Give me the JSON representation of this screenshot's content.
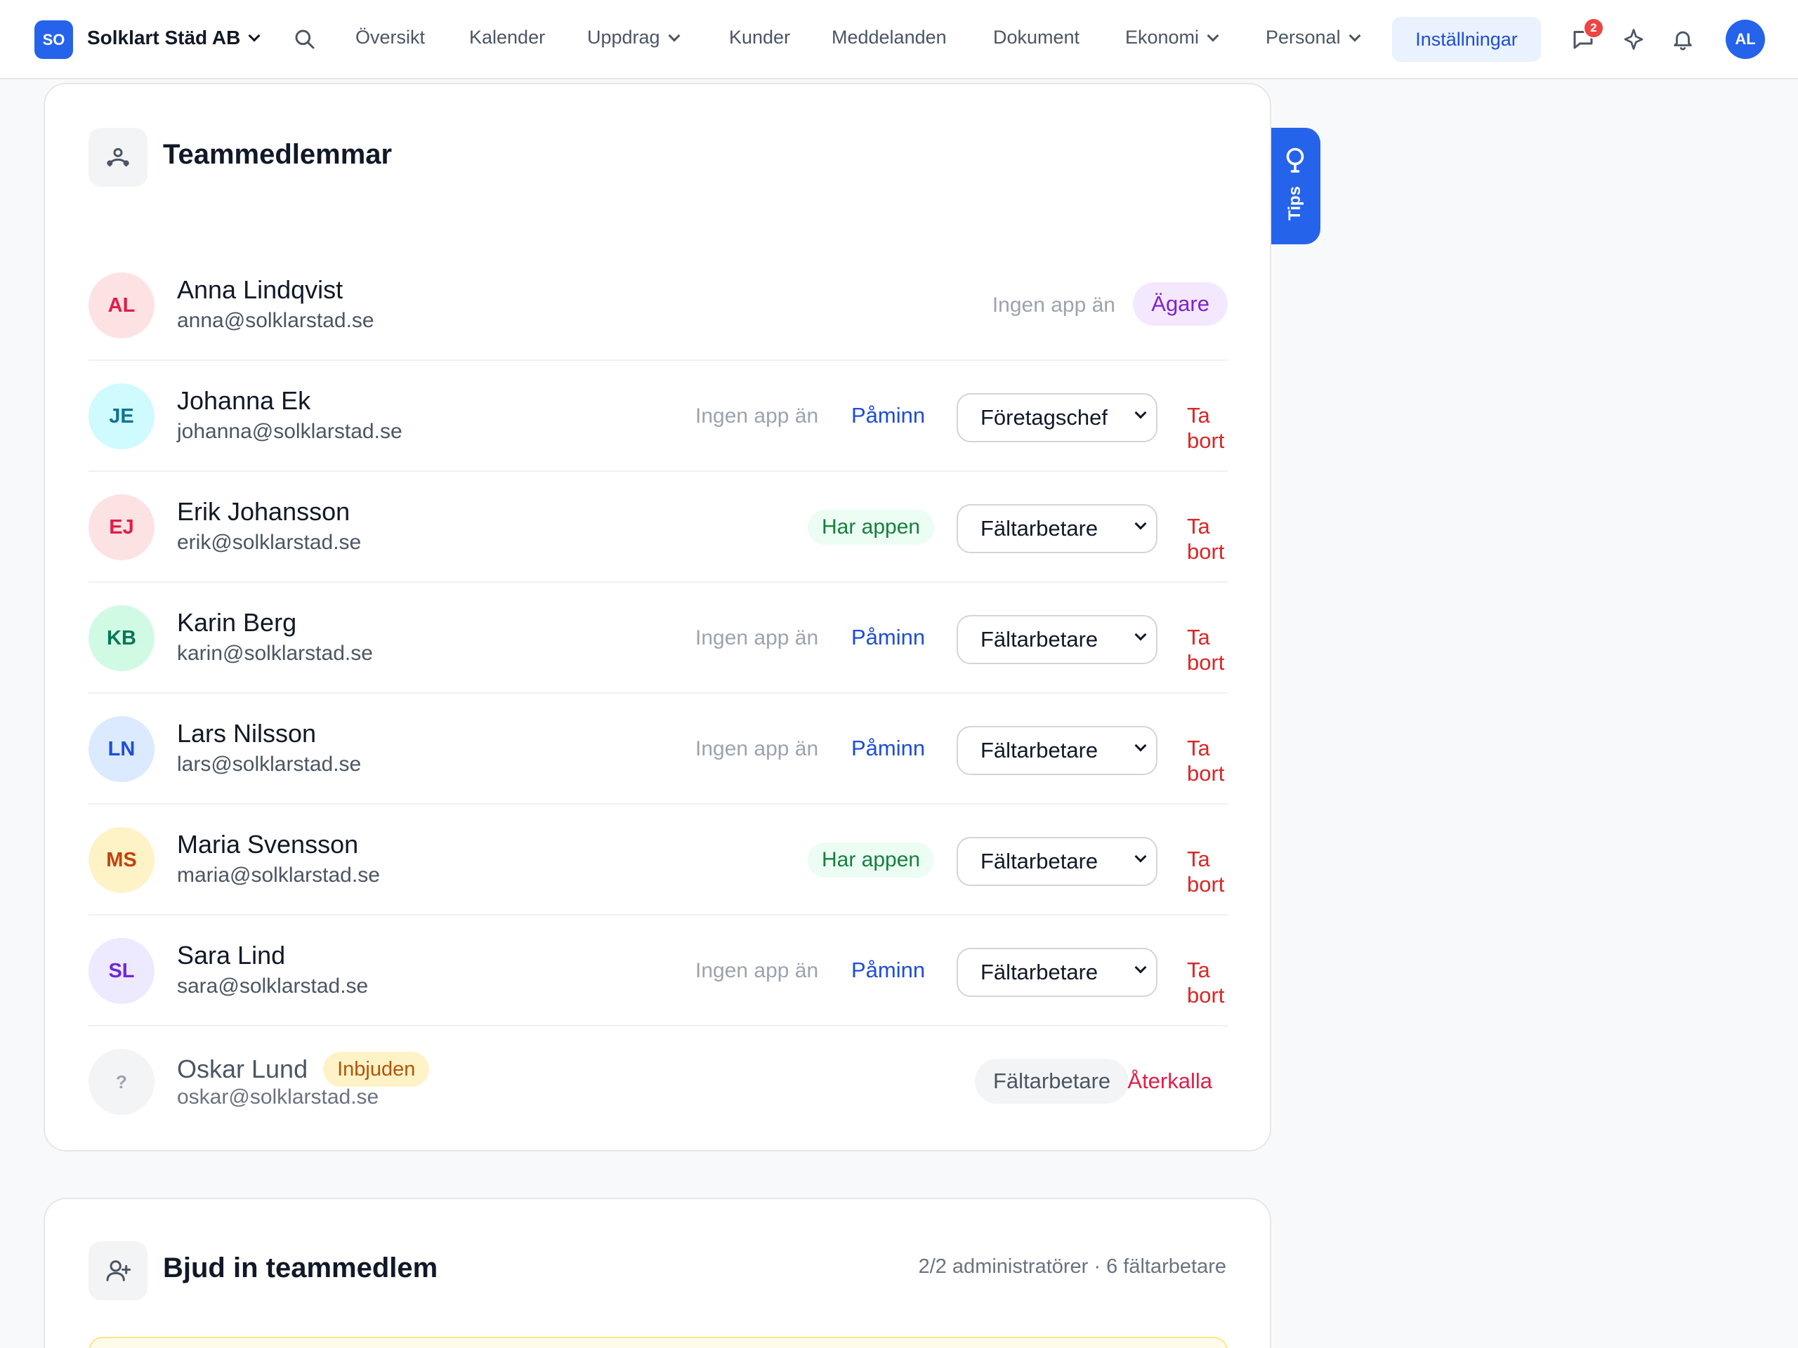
{
  "colors": {
    "primary": "#2563eb",
    "danger": "#dc2626",
    "success_bg": "#ecfdf3",
    "success_text": "#15803d",
    "owner_bg": "#f3e8ff",
    "owner_text": "#7e22ce",
    "invited_bg": "#fef3c7",
    "invited_text": "#b45309"
  },
  "nav": {
    "company_initials": "SO",
    "company_name": "Solklart Städ AB",
    "items": [
      {
        "label": "Översikt"
      },
      {
        "label": "Kalender"
      },
      {
        "label": "Uppdrag"
      },
      {
        "label": "Kunder"
      },
      {
        "label": "Meddelanden"
      },
      {
        "label": "Dokument"
      },
      {
        "label": "Ekonomi"
      },
      {
        "label": "Personal"
      },
      {
        "label": "Inställningar"
      }
    ],
    "message_badge": "2",
    "user_initials": "AL",
    "icons": [
      "search-icon",
      "chat-icon",
      "sparkle-icon",
      "bell-icon"
    ]
  },
  "tips": {
    "label": "Tips",
    "icon": "lightbulb-icon"
  },
  "team": {
    "title": "Teammedlemmar",
    "icon": "team-icon",
    "members": [
      {
        "initials": "AL",
        "name": "Anna Lindqvist",
        "email": "anna@solklarstad.se",
        "status": "Ingen app än",
        "role_badge": "Ägare",
        "avatar_bg": "#fde2e4",
        "avatar_fg": "#e11d48"
      },
      {
        "initials": "JE",
        "name": "Johanna Ek",
        "email": "johanna@solklarstad.se",
        "status": "Ingen app än",
        "remind": "Påminn",
        "role": "Företagschef",
        "remove": "Ta bort",
        "avatar_bg": "#cffafe",
        "avatar_fg": "#0e7490"
      },
      {
        "initials": "EJ",
        "name": "Erik Johansson",
        "email": "erik@solklarstad.se",
        "status": "Har appen",
        "role": "Fältarbetare",
        "remove": "Ta bort",
        "avatar_bg": "#fde2e4",
        "avatar_fg": "#e11d48"
      },
      {
        "initials": "KB",
        "name": "Karin Berg",
        "email": "karin@solklarstad.se",
        "status": "Ingen app än",
        "remind": "Påminn",
        "role": "Fältarbetare",
        "remove": "Ta bort",
        "avatar_bg": "#d1fae5",
        "avatar_fg": "#047857"
      },
      {
        "initials": "LN",
        "name": "Lars Nilsson",
        "email": "lars@solklarstad.se",
        "status": "Ingen app än",
        "remind": "Påminn",
        "role": "Fältarbetare",
        "remove": "Ta bort",
        "avatar_bg": "#dbeafe",
        "avatar_fg": "#1d4ed8"
      },
      {
        "initials": "MS",
        "name": "Maria Svensson",
        "email": "maria@solklarstad.se",
        "status": "Har appen",
        "role": "Fältarbetare",
        "remove": "Ta bort",
        "avatar_bg": "#fef3c7",
        "avatar_fg": "#c2410c"
      },
      {
        "initials": "SL",
        "name": "Sara Lind",
        "email": "sara@solklarstad.se",
        "status": "Ingen app än",
        "remind": "Påminn",
        "role": "Fältarbetare",
        "remove": "Ta bort",
        "avatar_bg": "#ede9fe",
        "avatar_fg": "#6d28d9"
      },
      {
        "initials": "?",
        "name": "Oskar Lund",
        "invited": "Inbjuden",
        "email": "oskar@solklarstad.se",
        "role": "Fältarbetare",
        "revoke": "Återkalla",
        "avatar_bg": "#f3f4f6",
        "avatar_fg": "#9ca3af"
      }
    ]
  },
  "invite": {
    "title": "Bjud in teammedlem",
    "icon": "add-user-icon",
    "meta": "2/2 administratörer · 6 fältarbetare"
  }
}
